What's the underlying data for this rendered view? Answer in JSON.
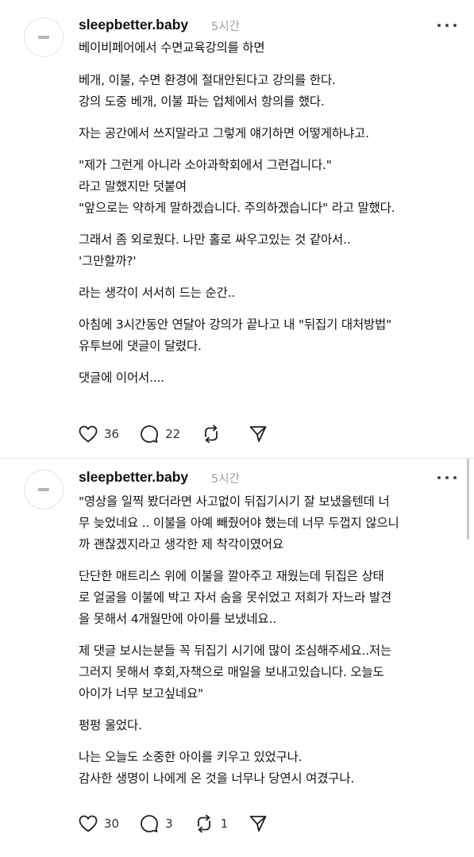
{
  "posts": [
    {
      "username": "sleepbetter.baby",
      "time": "5시간",
      "paragraphs": [
        "베이비페어에서 수면교육강의를 하면",
        "베개, 이불, 수면 환경에 절대안된다고 강의를 한다.\n강의 도중 베개, 이불 파는 업체에서 항의를 했다.",
        "자는 공간에서 쓰지말라고 그렇게 얘기하면 어떻게하냐고.",
        "\"제가 그런게 아니라 소아과학회에서 그런겁니다.\"\n라고 말했지만 덧붙여\n\"앞으로는 약하게 말하겠습니다. 주의하겠습니다\" 라고 말했다.",
        "그래서 좀 외로웠다. 나만 홀로 싸우고있는 것 같아서..\n'그만할까?'",
        "라는 생각이 서서히 드는 순간..",
        "아침에 3시간동안 연달아 강의가 끝나고 내 \"뒤집기 대처방법\"\n유투브에 댓글이 달렸다.",
        "댓글에 이어서...."
      ],
      "likes": "36",
      "comments": "22",
      "reposts": "",
      "icons": {
        "like": "heart-icon",
        "comment": "comment-bubble-icon",
        "repost": "repost-icon",
        "share": "send-icon",
        "more": "more-dots-icon"
      }
    },
    {
      "username": "sleepbetter.baby",
      "time": "5시간",
      "paragraphs": [
        "\"영상을 일찍 봤더라면 사고없이 뒤집기시기 잘 보냈을텐데 너\n무 늦었네요 .. 이불을 아예 빼줬어야 했는데 너무 두껍지 않으니\n까 괜찮겠지라고 생각한 제 착각이였어요",
        "단단한 매트리스 위에  이불을 깔아주고 재웠는데 뒤집은 상태\n로 얼굴을 이불에 박고 자서 숨을 못쉬었고 저희가 자느라 발견\n을 못해서 4개월만에 아이를 보냈네요..",
        "제 댓글 보시는분들 꼭 뒤집기 시기에 많이 조심해주세요..저는\n그러지 못해서 후회,자책으로 매일을 보내고있습니다. 오늘도\n아이가 너무 보고싶네요\"",
        "펑펑 울었다.",
        "나는 오늘도 소중한 아이를 키우고 있었구나.\n감사한 생명이 나에게 온 것을 너무나 당연시 여겼구나."
      ],
      "likes": "30",
      "comments": "3",
      "reposts": "1",
      "icons": {
        "like": "heart-icon",
        "comment": "comment-bubble-icon",
        "repost": "repost-icon",
        "share": "send-icon",
        "more": "more-dots-icon"
      }
    }
  ],
  "colors": {
    "text": "#151515",
    "muted": "#a0a0a0",
    "divider": "#e4e4e4",
    "icon": "#222222"
  }
}
